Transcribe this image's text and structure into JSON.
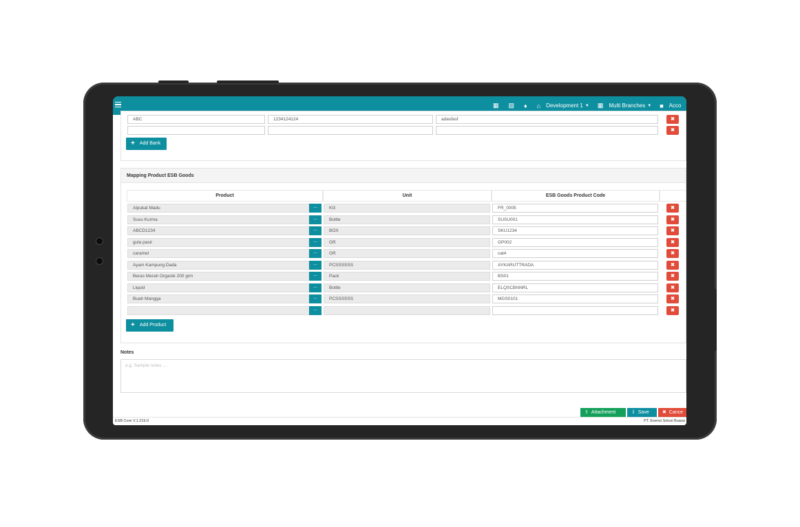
{
  "topbar": {
    "nav_icons": [
      "report-icon",
      "document-icon",
      "bell-icon",
      "home-icon"
    ],
    "branch_label": "Development 1",
    "multi_branches_label": "Multi Branches",
    "account_label": "Acco"
  },
  "bank": {
    "rows": [
      {
        "name": "ABC",
        "account": "1234124124",
        "holder": "adasfasf"
      },
      {
        "name": "",
        "account": "",
        "holder": ""
      }
    ],
    "add_button": "Add Bank"
  },
  "mapping": {
    "title": "Mapping Product ESB Goods",
    "columns": [
      "Product",
      "Unit",
      "ESB Goods Product Code"
    ],
    "rows": [
      {
        "product": "Alpukat Madu",
        "unit": "KG",
        "code": "FR_0005"
      },
      {
        "product": "Susu Kurma",
        "unit": "Bottle",
        "code": "SUSU001"
      },
      {
        "product": "ABCD1234",
        "unit": "BOX",
        "code": "SKU1234"
      },
      {
        "product": "gula pasir",
        "unit": "GR",
        "code": "GP002"
      },
      {
        "product": "caramel",
        "unit": "GR",
        "code": "cat4"
      },
      {
        "product": "Ayam Kampung Dada",
        "unit": "PCSSSSSS",
        "code": "AYKARUTTRADA"
      },
      {
        "product": "Beras Merah Organik 200 grm",
        "unit": "Pack",
        "code": "BS01"
      },
      {
        "product": "Liquid",
        "unit": "Bottle",
        "code": "ELQSCBNNRL"
      },
      {
        "product": "Buah Mangga",
        "unit": "PCSSSSSS",
        "code": "MGS0101"
      },
      {
        "product": "",
        "unit": "",
        "code": ""
      }
    ],
    "browse_label": "...",
    "delete_label": "✖",
    "add_button": "Add Product"
  },
  "notes": {
    "label": "Notes",
    "placeholder": "e.g. Sample notes ...."
  },
  "actions": {
    "attachment": "Attachment",
    "save": "Save",
    "cancel": "Cance"
  },
  "status": {
    "version": "ESB Core V.1.219.0",
    "company": "PT. Esensi Solusi Buana"
  },
  "colors": {
    "primary": "#0e8fa0",
    "danger": "#e04b3a",
    "success": "#14a05a"
  }
}
